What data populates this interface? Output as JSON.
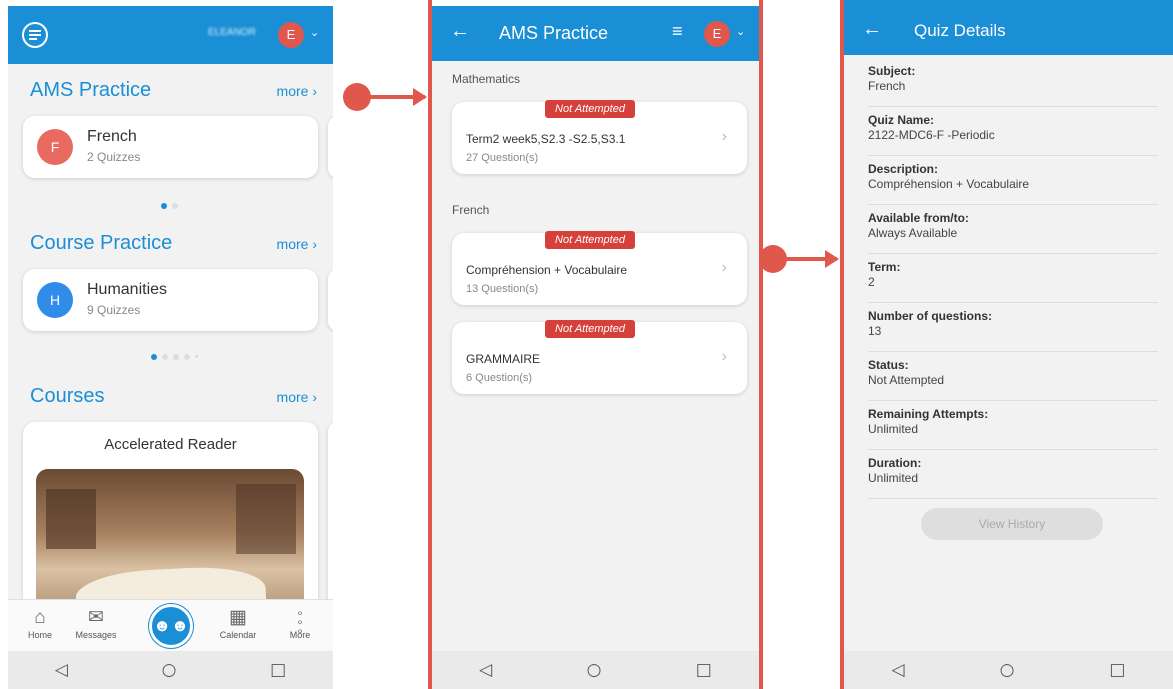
{
  "colors": {
    "accent": "#1a8fd6",
    "annotation": "#e0574c",
    "badge": "#d6403a"
  },
  "phone1": {
    "header": {
      "user_name": "ELEANOR",
      "avatar_letter": "E"
    },
    "sections": [
      {
        "title": "AMS Practice",
        "more": "more ›",
        "card": {
          "letter": "F",
          "title": "French",
          "sub": "2 Quizzes",
          "color": "#e96a5e"
        }
      },
      {
        "title": "Course Practice",
        "more": "more ›",
        "card": {
          "letter": "H",
          "title": "Humanities",
          "sub": "9 Quizzes",
          "color": "#2f8ce8"
        }
      },
      {
        "title": "Courses",
        "more": "more ›",
        "card": {
          "title": "Accelerated Reader"
        }
      }
    ],
    "nav": {
      "home": "Home",
      "messages": "Messages",
      "calendar": "Calendar",
      "more": "More"
    }
  },
  "phone2": {
    "title": "AMS Practice",
    "avatar_letter": "E",
    "groups": [
      {
        "label": "Mathematics",
        "items": [
          {
            "badge": "Not Attempted",
            "title": "Term2 week5,S2.3 -S2.5,S3.1",
            "sub": "27 Question(s)"
          }
        ]
      },
      {
        "label": "French",
        "items": [
          {
            "badge": "Not Attempted",
            "title": "Compréhension + Vocabulaire",
            "sub": "13 Question(s)"
          },
          {
            "badge": "Not Attempted",
            "title": "GRAMMAIRE",
            "sub": "6 Question(s)"
          }
        ]
      }
    ]
  },
  "phone3": {
    "title": "Quiz Details",
    "rows": [
      {
        "label": "Subject:",
        "value": "French"
      },
      {
        "label": "Quiz Name:",
        "value": "2122-MDC6-F -Periodic"
      },
      {
        "label": "Description:",
        "value": "Compréhension + Vocabulaire"
      },
      {
        "label": "Available from/to:",
        "value": "Always Available"
      },
      {
        "label": "Term:",
        "value": "2"
      },
      {
        "label": "Number of questions:",
        "value": "13"
      },
      {
        "label": "Status:",
        "value": "Not Attempted"
      },
      {
        "label": "Remaining Attempts:",
        "value": "Unlimited"
      },
      {
        "label": "Duration:",
        "value": "Unlimited"
      }
    ],
    "button": "View History"
  },
  "android_nav": {
    "back": "◁",
    "home": "○",
    "recent": "□"
  }
}
